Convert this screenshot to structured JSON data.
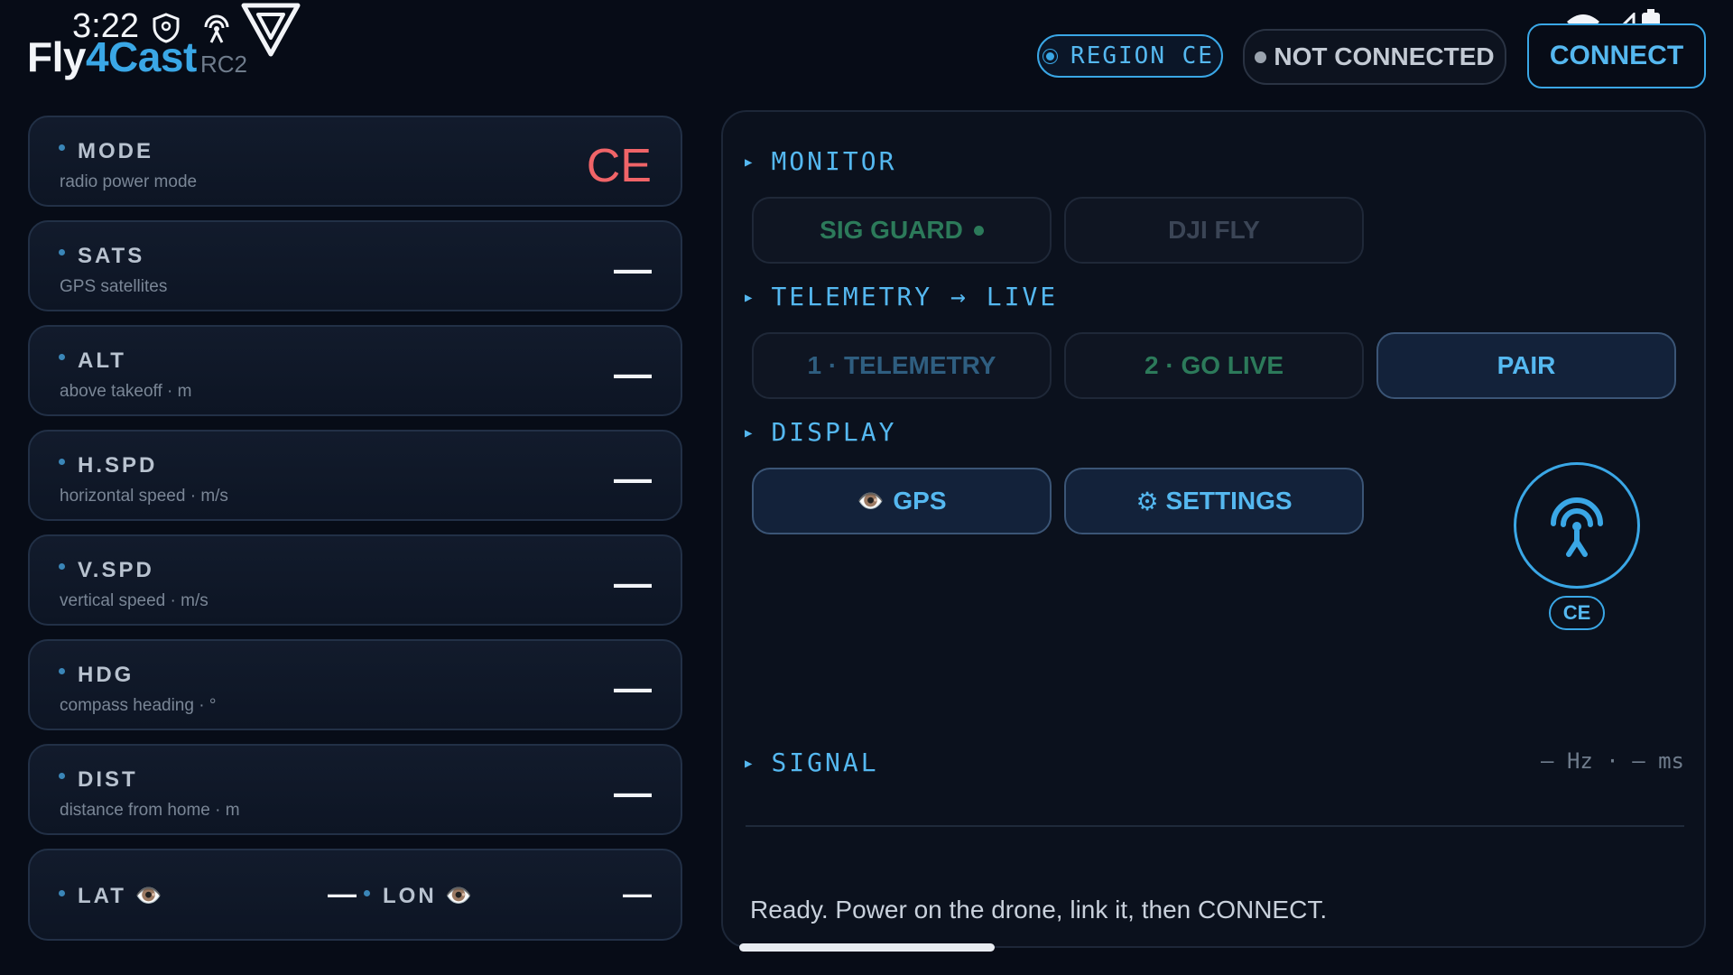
{
  "status_bar": {
    "time": "3:22",
    "icons": [
      "shield-icon",
      "hotspot-icon",
      "app-logo-icon",
      "wifi-icon",
      "cell-signal-icon",
      "battery-icon"
    ]
  },
  "brand": {
    "name_part1": "Fly",
    "name_part2": "4Cast",
    "model": "RC2"
  },
  "header": {
    "region_label": "REGION CE",
    "connection_status": "NOT CONNECTED",
    "connect_button": "CONNECT"
  },
  "stats": [
    {
      "label": "MODE",
      "sub": "radio power mode",
      "value": "CE"
    },
    {
      "label": "SATS",
      "sub": "GPS satellites",
      "value": "—"
    },
    {
      "label": "ALT",
      "sub": "above takeoff · m",
      "value": "—"
    },
    {
      "label": "H.SPD",
      "sub": "horizontal speed · m/s",
      "value": "—"
    },
    {
      "label": "V.SPD",
      "sub": "vertical speed · m/s",
      "value": "—"
    },
    {
      "label": "HDG",
      "sub": "compass heading · °",
      "value": "—"
    },
    {
      "label": "DIST",
      "sub": "distance from home · m",
      "value": "—"
    }
  ],
  "latlon": {
    "lat_label": "LAT",
    "lat_value": "—",
    "lon_label": "LON",
    "lon_value": "—",
    "eye_glyph": "👁️"
  },
  "panel": {
    "monitor": {
      "title": "MONITOR",
      "sig_guard": "SIG GUARD",
      "dji_fly": "DJI FLY"
    },
    "telemetry": {
      "title": "TELEMETRY → LIVE",
      "step1": "1 · TELEMETRY",
      "step2": "2 · GO LIVE",
      "pair": "PAIR"
    },
    "display": {
      "title": "DISPLAY",
      "gps": "GPS",
      "settings": "SETTINGS",
      "gps_glyph": "👁️",
      "settings_glyph": "⚙"
    },
    "region_badge": "CE",
    "signal": {
      "title": "SIGNAL",
      "readout": "— Hz · — ms"
    },
    "status_message": "Ready. Power on the drone, link it, then CONNECT."
  },
  "colors": {
    "accent": "#3aa7e6",
    "background": "#070c17",
    "mode_value": "#f06468",
    "sig_guard": "#2c7a5a"
  }
}
